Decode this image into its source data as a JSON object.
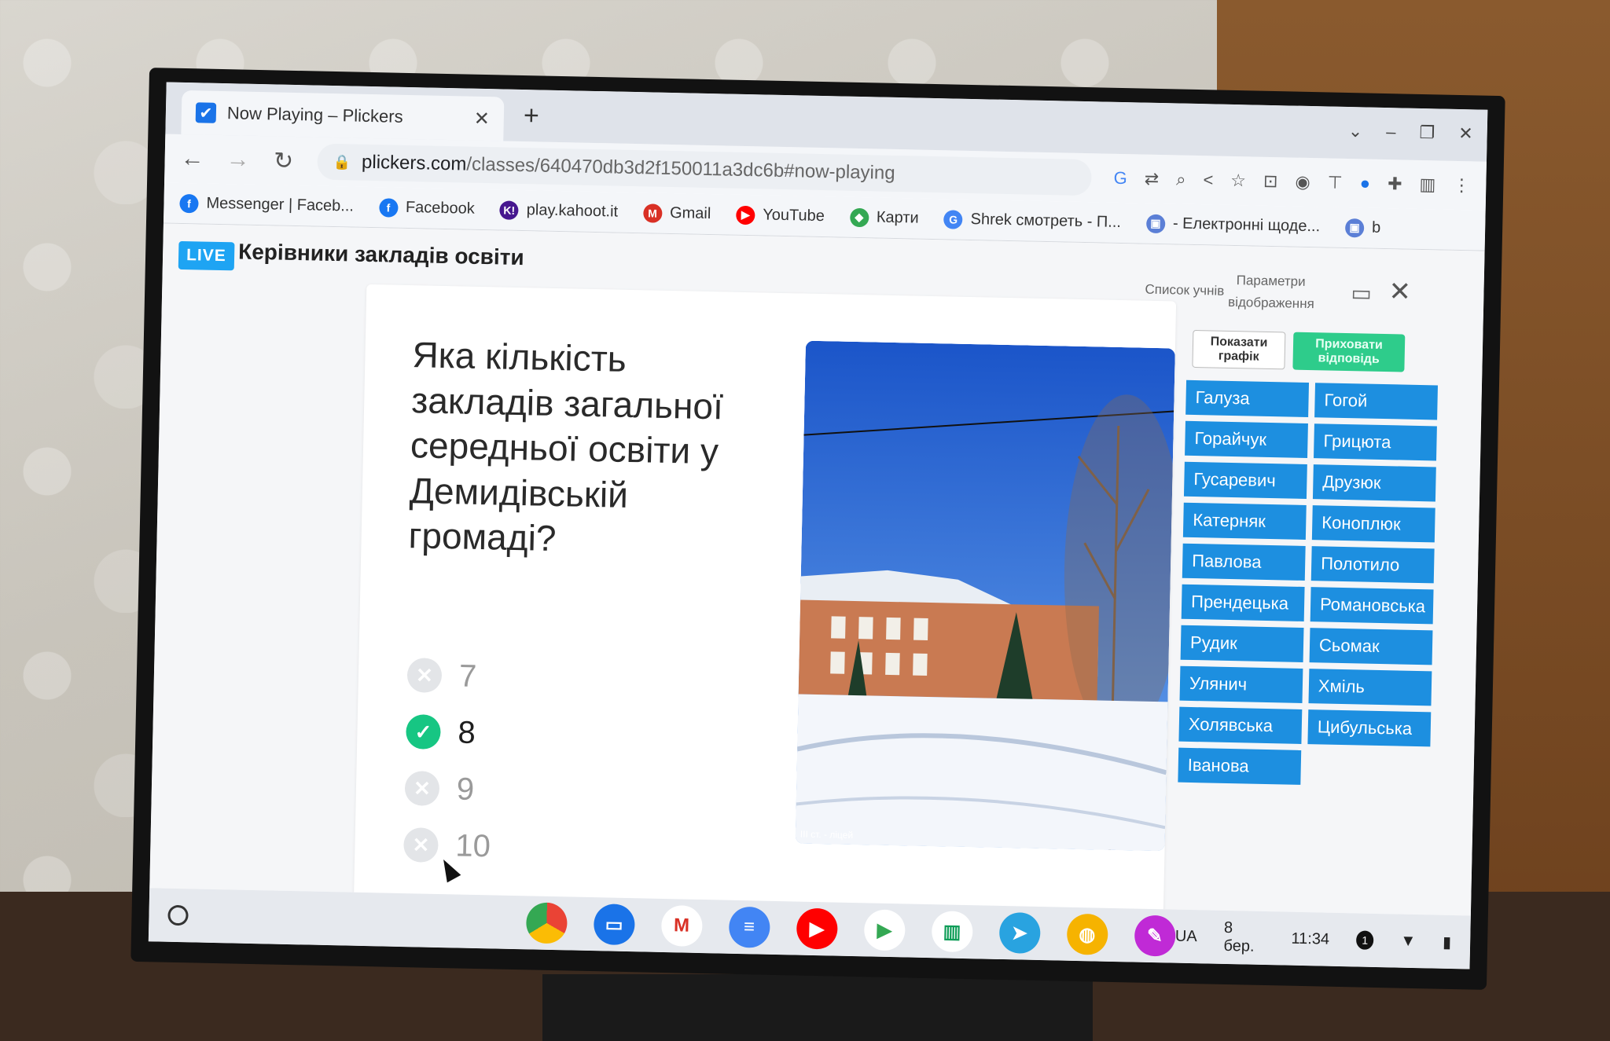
{
  "browser": {
    "tab_title": "Now Playing – Plickers",
    "url_host": "plickers.com",
    "url_path": "/classes/640470db3d2f150011a3dc6b#now-playing",
    "bookmarks": [
      {
        "label": "Messenger | Faceb...",
        "color": "#1877f2",
        "icon": "f"
      },
      {
        "label": "Facebook",
        "color": "#1877f2",
        "icon": "f"
      },
      {
        "label": "play.kahoot.it",
        "color": "#46178f",
        "icon": "K!"
      },
      {
        "label": "Gmail",
        "color": "#d93025",
        "icon": "M"
      },
      {
        "label": "YouTube",
        "color": "#ff0000",
        "icon": "▶"
      },
      {
        "label": "Карти",
        "color": "#34a853",
        "icon": "◆"
      },
      {
        "label": "Shrek смотреть - П...",
        "color": "#4285f4",
        "icon": "G"
      },
      {
        "label": "- Електронні щоде...",
        "color": "#5b7fd6",
        "icon": "▣"
      },
      {
        "label": "b",
        "color": "#5b7fd6",
        "icon": "▣"
      }
    ]
  },
  "plickers": {
    "live_label": "LIVE",
    "class_name": "Керівники закладів освіти",
    "student_list_link": "Список учнів",
    "display_settings_link_1": "Параметри",
    "display_settings_link_2": "відображення",
    "show_graph_button": "Показати графік",
    "hide_answer_button": "Приховати відповідь",
    "question": "Яка кількість закладів загальної середньої освіти у Демидівській громаді?",
    "choices": [
      {
        "text": "7",
        "correct": false
      },
      {
        "text": "8",
        "correct": true
      },
      {
        "text": "9",
        "correct": false
      },
      {
        "text": "10",
        "correct": false
      }
    ],
    "photo_caption": "ІІІ ст. - ліцей",
    "students": [
      "Галуза",
      "Гогой",
      "Горайчук",
      "Грицюта",
      "Гусаревич",
      "Друзюк",
      "Катерняк",
      "Коноплюк",
      "Павлова",
      "Полотило",
      "Прендецька",
      "Романовська",
      "Рудик",
      "Сьомак",
      "Улянич",
      "Хміль",
      "Холявська",
      "Цибульська",
      "Іванова"
    ]
  },
  "taskbar": {
    "language": "UA",
    "date": "8 бер.",
    "time": "11:34",
    "notification_count": "1"
  }
}
